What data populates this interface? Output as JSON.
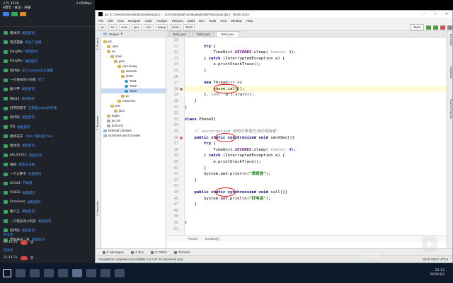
{
  "chat": {
    "header": {
      "line1_left": "人气 3518",
      "line1_right": "2.05Mbps",
      "line2": "6周年 · 关注 · 开播"
    },
    "messages": [
      {
        "user": "雨沐鸿",
        "text": "发起提问"
      },
      {
        "user": "吃货孤独",
        "text": "关注了主播"
      },
      {
        "user": "FangMu",
        "text": "发起提问"
      },
      {
        "user": "FangMu",
        "text": "发起提问"
      },
      {
        "user": "码代码",
        "text": "这个volatile怎么理解"
      },
      {
        "user": "一只快乐的小码农",
        "text": "赞了"
      },
      {
        "user": "路人甲",
        "text": "发起提问"
      },
      {
        "user": "阿K25",
        "text": "提问很好"
      },
      {
        "user": "好学的孩子",
        "text": "这就是static同步锁"
      },
      {
        "user": "码代码",
        "text": "发起提问"
      },
      {
        "user": "QQ",
        "text": "发起提问"
      },
      {
        "user": "静待花开",
        "text": "static 锁的是class"
      },
      {
        "user": "雨沐鸿",
        "text": "发起提问"
      },
      {
        "user": "bili_87231",
        "text": "发起提问"
      },
      {
        "user": "铁粉",
        "text": "静态方法锁"
      },
      {
        "user": "一个大胖子",
        "text": "发起提问"
      },
      {
        "user": "04143",
        "text": "不知道"
      },
      {
        "user": "91833",
        "text": "发起提问"
      },
      {
        "user": "kamikaze",
        "text": "发起提问"
      },
      {
        "user": "路人乙",
        "text": "发起提问"
      },
      {
        "user": "一只快乐的小码农",
        "text": "发起提问"
      },
      {
        "user": "码代码",
        "text": "发起提问"
      },
      {
        "user": "老板来份二哥",
        "text": "发起提问"
      }
    ],
    "footer": [
      {
        "name": "阿沐鸿",
        "time": "22:14:21",
        "text": "赞"
      },
      {
        "name": "阿沐鸿",
        "time": "22:14:21",
        "text": "赞"
      }
    ]
  },
  "ide": {
    "title": "juc [C:\\Users\\Administrator\\Desktop\\juc] - ...\\src\\main\\java\\com\\kuang\\lock8\\Test3.java [juc] - IntelliJ IDEA",
    "menu": [
      "File",
      "Edit",
      "View",
      "Navigate",
      "Code",
      "Analyze",
      "Refactor",
      "Build",
      "Run",
      "Tools",
      "VCS",
      "Window",
      "Help"
    ],
    "breadcrumbs": [
      "juc",
      "src",
      "main",
      "java",
      "com",
      "kuang",
      "lock8",
      "Test3"
    ],
    "run_config": "Test3",
    "project_label": "Project",
    "tree": [
      {
        "label": "juc",
        "icon": "folder",
        "depth": 0
      },
      {
        "label": ".idea",
        "icon": "folder",
        "depth": 1
      },
      {
        "label": "src",
        "icon": "folder",
        "depth": 1
      },
      {
        "label": "main",
        "icon": "folder",
        "depth": 2
      },
      {
        "label": "java",
        "icon": "folder",
        "depth": 3
      },
      {
        "label": "com.kuang",
        "icon": "folder",
        "depth": 4
      },
      {
        "label": "demo01",
        "icon": "folder",
        "depth": 5
      },
      {
        "label": "lock8",
        "icon": "folder",
        "depth": 5
      },
      {
        "label": "Test1",
        "icon": "class",
        "depth": 6
      },
      {
        "label": "Test2",
        "icon": "class",
        "depth": 6
      },
      {
        "label": "Test3",
        "icon": "class",
        "depth": 6
      },
      {
        "label": "pc",
        "icon": "folder",
        "depth": 5
      },
      {
        "label": "resources",
        "icon": "folder",
        "depth": 4
      },
      {
        "label": "test",
        "icon": "folder",
        "depth": 2
      },
      {
        "label": "java",
        "icon": "folder",
        "depth": 3
      },
      {
        "label": "target",
        "icon": "folder",
        "depth": 1
      },
      {
        "label": "juc.iml",
        "icon": "file",
        "depth": 1
      },
      {
        "label": "pom.xml",
        "icon": "file",
        "depth": 1
      },
      {
        "label": "External Libraries",
        "icon": "lib",
        "depth": 0
      },
      {
        "label": "Scratches and Consoles",
        "icon": "lib",
        "depth": 0
      }
    ],
    "left_tabs": [
      "1: Project",
      "7: Structure",
      "2: Favorites"
    ],
    "right_tabs": [
      "Ant Build",
      "Database",
      "Maven Projects"
    ],
    "editor_tabs": [
      {
        "label": "Test1.java",
        "active": false
      },
      {
        "label": "Test2.java",
        "active": false
      },
      {
        "label": "Test3.java",
        "active": true
      }
    ],
    "line_numbers": [
      "20",
      "21",
      "22",
      "23",
      "24",
      "25",
      "26",
      "27",
      "28",
      "29",
      "30",
      "31",
      "32",
      "33",
      "34",
      "35",
      "36",
      "37",
      "38",
      "39",
      "40",
      "41",
      "42",
      "43",
      "44",
      "45",
      "46",
      "47",
      "48",
      "49",
      "50",
      "51"
    ],
    "code": {
      "l21_a": "try",
      "l21_b": " {",
      "l22_a": "TimeUnit.",
      "l22_b": "SECONDS",
      "l22_c": ".sleep( ",
      "l22_d": "timeout: ",
      "l22_e": "1",
      "l22_f": ");",
      "l23_a": "} ",
      "l23_b": "catch",
      "l23_c": " (InterruptedException e) {",
      "l24": "e.printStackTrace();",
      "l25": "}",
      "l27_a": "new",
      "l27_b": " Thread(()->{",
      "l28": "phone.call();",
      "l29_a": "}, ",
      "l29_b": "name: ",
      "l29_c": "\"B\"",
      "l29_d": ").start();",
      "l30": "}",
      "l31": "}",
      "l33_a": "class",
      "l33_b": " Phone3{",
      "l35": "// synchronized 锁的对象是方法的调用者! ",
      "l36_a": "public",
      "l36_b": " static",
      "l36_c": " synchronized",
      "l36_d": " void",
      "l36_e": " sendSms(){",
      "l37_a": "try",
      "l37_b": " {",
      "l38_a": "TimeUnit.",
      "l38_b": "SECONDS",
      "l38_c": ".sleep( ",
      "l38_d": "timeout: ",
      "l38_e": "4",
      "l38_f": ");",
      "l39_a": "} ",
      "l39_b": "catch",
      "l39_c": " (InterruptedException e) {",
      "l40": "e.printStackTrace();",
      "l41": "}",
      "l42_a": "System.",
      "l42_b": "out",
      "l42_c": ".println(",
      "l42_d": "\"发短信\"",
      "l42_e": ");",
      "l43": "}",
      "l45_a": "public",
      "l45_b": " static",
      "l45_c": " synchronized",
      "l45_d": " void",
      "l45_e": " call(){",
      "l46_a": "System.",
      "l46_b": "out",
      "l46_c": ".println(",
      "l46_d": "\"打电话\"",
      "l46_e": ");",
      "l47": "}",
      "l50": "}"
    },
    "code_breadcrumb": [
      "Phone3",
      "sendSms()"
    ],
    "bottom_tools": [
      "6: Messages",
      "4: Run",
      "6: TODO",
      "Terminal"
    ],
    "status_text": "Compilation completed successfully in 2 s 37 ms (moments ago)",
    "status_right": "36:30  CRLF  UTF-8"
  },
  "taskbar": {
    "time": "22:13",
    "date": "2020/3/2"
  },
  "watermark": "哔哩哔哩"
}
